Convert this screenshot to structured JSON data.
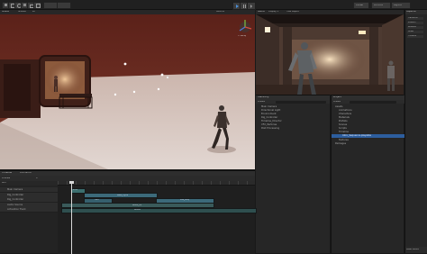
{
  "toolbar": {
    "account_label": "Account",
    "layout_label": "Layout",
    "collab_label": "Collab",
    "tool_icons": [
      "hand-icon",
      "move-icon",
      "rotate-icon",
      "scale-icon",
      "rect-icon",
      "transform-icon"
    ],
    "play_icons": [
      "play-icon",
      "pause-icon",
      "step-icon"
    ]
  },
  "scene": {
    "tab_label": "Scene",
    "shading_mode": "Shaded",
    "mode_2d": "2D",
    "gizmos_label": "Gizmos",
    "axis_label": "< Persp"
  },
  "game": {
    "tab_label": "Game",
    "display_label": "Display 1",
    "aspect_label": "Free Aspect"
  },
  "hierarchy": {
    "tab_label": "Hierarchy",
    "create_label": "Create",
    "items": [
      "Main Camera",
      "Directional Light",
      "Environment",
      "Rig_Controller",
      "Timeline_Director",
      "VFX_Particles",
      "Post Processing"
    ]
  },
  "project": {
    "tab_label": "Project",
    "create_label": "Create",
    "folders": [
      "Assets",
      "Animations",
      "Characters",
      "Materials",
      "Prefabs",
      "Scenes",
      "Scripts",
      "Timeline",
      "Textures",
      "Packages"
    ],
    "selected_file": "Intro_Sequence.playable"
  },
  "inspector": {
    "tab_label": "Inspector",
    "rows": [
      "Transform",
      "Position",
      "Rotation",
      "Scale",
      "Timeline"
    ],
    "footer_label": "Asset Labels"
  },
  "timeline": {
    "tab_label": "Timeline",
    "animation_tab": "Animation",
    "preview_label": "Preview",
    "frame_value": "0",
    "add_label": "Add",
    "tracks": [
      {
        "name": "Main Camera"
      },
      {
        "name": "Rig_Controller"
      },
      {
        "name": "Rig_Controller"
      },
      {
        "name": "Audio Source"
      },
      {
        "name": "Activation Track"
      }
    ],
    "clips": [
      "Intro",
      "Walk_Cycle",
      "Idle_Loop",
      "Turn",
      "Audio_01",
      "Active"
    ]
  },
  "colors": {
    "scene_wall": "#6e2d22",
    "scene_floor": "#d6c4bd",
    "panel": "#2a2a2a",
    "selection": "#2d5e9e",
    "clip_teal": "#3b6e6e",
    "clip_anim": "#3c6a7a"
  }
}
